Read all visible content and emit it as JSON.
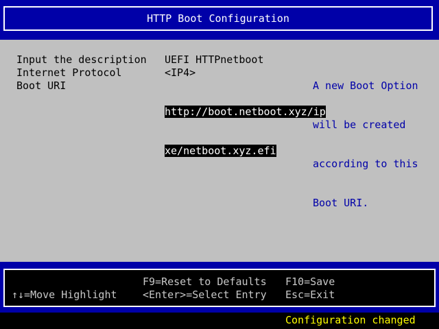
{
  "header": {
    "title": "HTTP Boot Configuration"
  },
  "form": {
    "rows": [
      {
        "label": "Input the description",
        "value": "UEFI HTTPnetboot"
      },
      {
        "label": "Internet Protocol",
        "value": "<IP4>"
      },
      {
        "label": "Boot URI",
        "value_line1": "http://boot.netboot.xyz/ip",
        "value_line2": "xe/netboot.xyz.efi"
      }
    ]
  },
  "help": {
    "lines": [
      "A new Boot Option",
      "will be created",
      "according to this",
      "Boot URI."
    ]
  },
  "footer": {
    "move_highlight": "↑↓=Move Highlight",
    "reset_defaults": "F9=Reset to Defaults",
    "select_entry": "<Enter>=Select Entry",
    "save": "F10=Save",
    "exit": "Esc=Exit"
  },
  "status": {
    "message": "Configuration changed"
  },
  "colors": {
    "blue": "#0000a8",
    "grey": "#c0c0c0",
    "yellow": "#ffff00"
  }
}
